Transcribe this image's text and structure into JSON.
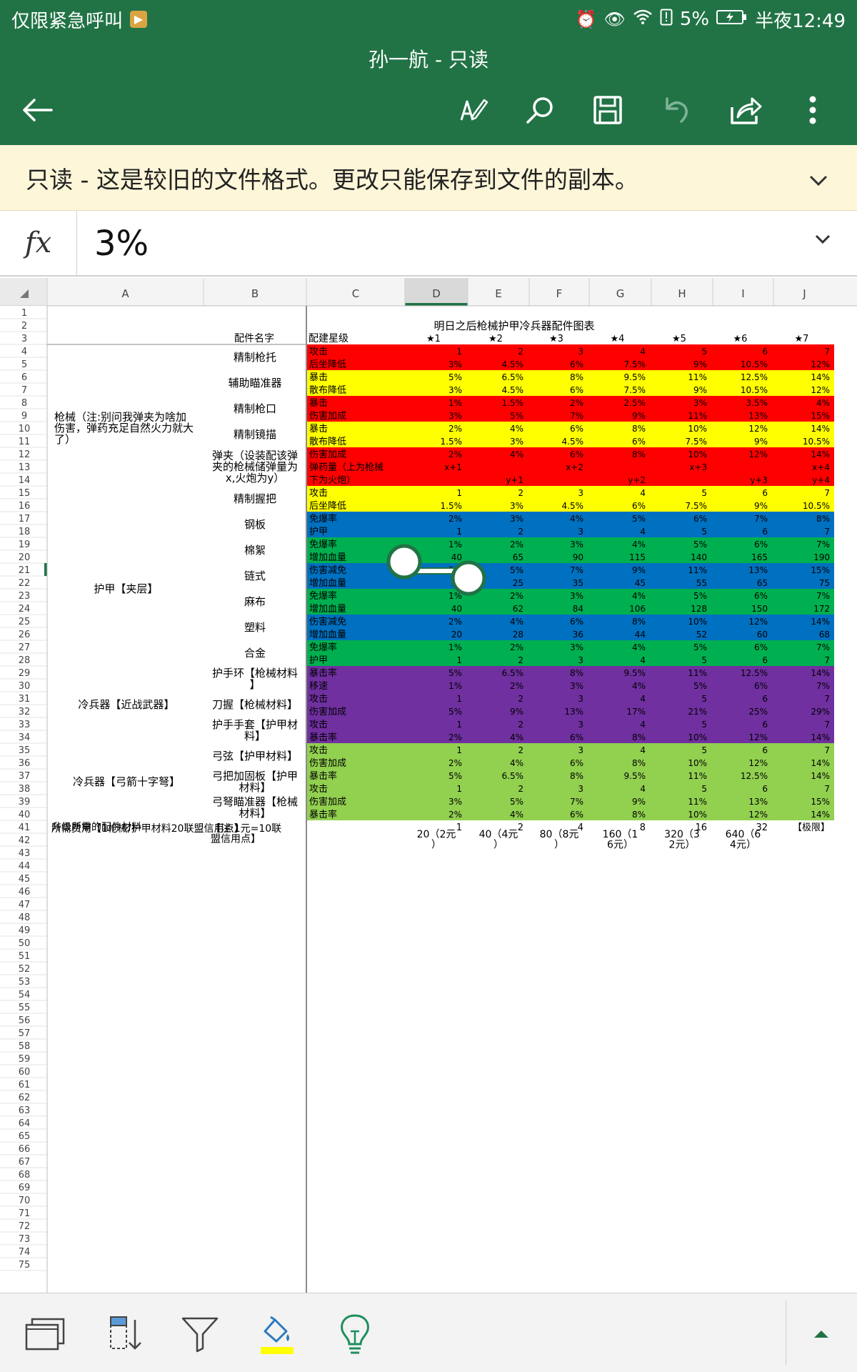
{
  "status": {
    "carrier": "仅限紧急呼叫",
    "battery": "5%",
    "time": "半夜12:49"
  },
  "appbar": {
    "title": "孙一航 - 只读",
    "icons": [
      "back-arrow-icon",
      "draw-pen-icon",
      "search-icon",
      "save-icon",
      "undo-icon",
      "share-icon",
      "more-vert-icon"
    ]
  },
  "banner": {
    "text": "只读 - 这是较旧的文件格式。更改只能保存到文件的副本。"
  },
  "formula": {
    "fx": "fx",
    "value": "3%"
  },
  "colors": {
    "red": "#ff0000",
    "yellow": "#ffff00",
    "blue": "#0070c0",
    "green": "#00b050",
    "purple": "#7030a0",
    "lime": "#92d050",
    "excel_green": "#217346"
  },
  "sheet": {
    "columns": [
      "A",
      "B",
      "C",
      "D",
      "E",
      "F",
      "G",
      "H",
      "I",
      "J"
    ],
    "selected_column": "D",
    "selected_row": 21,
    "row_count": 75,
    "title": "明日之后枪械护甲冷兵器配件图表",
    "header_row": {
      "b": "配件名字",
      "c": "配建星级",
      "stars": [
        "★1",
        "★2",
        "★3",
        "★4",
        "★5",
        "★6",
        "★7"
      ]
    },
    "groups": [
      {
        "start": 4,
        "end": 16,
        "text": "枪械（注:别问我弹夹为啥加伤害，弹药充足自然火力就大了）"
      },
      {
        "start": 17,
        "end": 28,
        "text": "护甲【夹层】"
      },
      {
        "start": 29,
        "end": 34,
        "text": "冷兵器【近战武器】"
      },
      {
        "start": 35,
        "end": 40,
        "text": "冷兵器【弓箭十字弩】"
      }
    ],
    "parts": [
      {
        "start": 4,
        "end": 5,
        "name": "精制枪托"
      },
      {
        "start": 6,
        "end": 7,
        "name": "辅助瞄准器"
      },
      {
        "start": 8,
        "end": 9,
        "name": "精制枪口"
      },
      {
        "start": 10,
        "end": 11,
        "name": "精制镜描"
      },
      {
        "start": 12,
        "end": 14,
        "name": "弹夹（设装配该弹夹的枪械储弹量为x,火炮为y）"
      },
      {
        "start": 15,
        "end": 16,
        "name": "精制握把"
      },
      {
        "start": 17,
        "end": 18,
        "name": "钢板"
      },
      {
        "start": 19,
        "end": 20,
        "name": "棉絮"
      },
      {
        "start": 21,
        "end": 22,
        "name": "链式"
      },
      {
        "start": 23,
        "end": 24,
        "name": "麻布"
      },
      {
        "start": 25,
        "end": 26,
        "name": "塑料"
      },
      {
        "start": 27,
        "end": 28,
        "name": "合金"
      },
      {
        "start": 29,
        "end": 30,
        "name": "护手环【枪械材料】"
      },
      {
        "start": 31,
        "end": 32,
        "name": "刀握【枪械材料】"
      },
      {
        "start": 33,
        "end": 34,
        "name": "护手手套【护甲材料】"
      },
      {
        "start": 35,
        "end": 36,
        "name": "弓弦【护甲材料】"
      },
      {
        "start": 37,
        "end": 38,
        "name": "弓把加固板【护甲材料】"
      },
      {
        "start": 39,
        "end": 40,
        "name": "弓弩瞄准器【枪械材料】"
      }
    ],
    "rows": [
      {
        "r": 4,
        "color": "red",
        "label": "攻击",
        "values": [
          "1",
          "2",
          "3",
          "4",
          "5",
          "6",
          "7"
        ]
      },
      {
        "r": 5,
        "color": "red",
        "label": "后坐降低",
        "values": [
          "3%",
          "4.5%",
          "6%",
          "7.5%",
          "9%",
          "10.5%",
          "12%"
        ]
      },
      {
        "r": 6,
        "color": "yellow",
        "label": "暴击",
        "values": [
          "5%",
          "6.5%",
          "8%",
          "9.5%",
          "11%",
          "12.5%",
          "14%"
        ]
      },
      {
        "r": 7,
        "color": "yellow",
        "label": "散布降低",
        "values": [
          "3%",
          "4.5%",
          "6%",
          "7.5%",
          "9%",
          "10.5%",
          "12%"
        ]
      },
      {
        "r": 8,
        "color": "red",
        "label": "暴击",
        "values": [
          "1%",
          "1.5%",
          "2%",
          "2.5%",
          "3%",
          "3.5%",
          "4%"
        ]
      },
      {
        "r": 9,
        "color": "red",
        "label": "伤害加成",
        "values": [
          "3%",
          "5%",
          "7%",
          "9%",
          "11%",
          "13%",
          "15%"
        ]
      },
      {
        "r": 10,
        "color": "yellow",
        "label": "暴击",
        "values": [
          "2%",
          "4%",
          "6%",
          "8%",
          "10%",
          "12%",
          "14%"
        ]
      },
      {
        "r": 11,
        "color": "yellow",
        "label": "散布降低",
        "values": [
          "1.5%",
          "3%",
          "4.5%",
          "6%",
          "7.5%",
          "9%",
          "10.5%"
        ]
      },
      {
        "r": 12,
        "color": "red",
        "label": "伤害加成",
        "values": [
          "2%",
          "4%",
          "6%",
          "8%",
          "10%",
          "12%",
          "14%"
        ]
      },
      {
        "r": 13,
        "color": "red",
        "label": "弹药量（上为枪械",
        "values": [
          "x+1",
          "",
          "x+2",
          "",
          "x+3",
          "",
          "x+4"
        ]
      },
      {
        "r": 14,
        "color": "red",
        "label": "下为火炮）",
        "values": [
          "",
          "y+1",
          "",
          "y+2",
          "",
          "y+3",
          "y+4"
        ]
      },
      {
        "r": 15,
        "color": "yellow",
        "label": "攻击",
        "values": [
          "1",
          "2",
          "3",
          "4",
          "5",
          "6",
          "7"
        ]
      },
      {
        "r": 16,
        "color": "yellow",
        "label": "后坐降低",
        "values": [
          "1.5%",
          "3%",
          "4.5%",
          "6%",
          "7.5%",
          "9%",
          "10.5%"
        ]
      },
      {
        "r": 17,
        "color": "blue",
        "label": "免爆率",
        "values": [
          "2%",
          "3%",
          "4%",
          "5%",
          "6%",
          "7%",
          "8%"
        ]
      },
      {
        "r": 18,
        "color": "blue",
        "label": "护甲",
        "values": [
          "1",
          "2",
          "3",
          "4",
          "5",
          "6",
          "7"
        ]
      },
      {
        "r": 19,
        "color": "green",
        "label": "免爆率",
        "values": [
          "1%",
          "2%",
          "3%",
          "4%",
          "5%",
          "6%",
          "7%"
        ]
      },
      {
        "r": 20,
        "color": "green",
        "label": "增加血量",
        "values": [
          "40",
          "65",
          "90",
          "115",
          "140",
          "165",
          "190"
        ]
      },
      {
        "r": 21,
        "color": "blue",
        "label": "伤害减免",
        "values": [
          "3%",
          "5%",
          "7%",
          "9%",
          "11%",
          "13%",
          "15%"
        ]
      },
      {
        "r": 22,
        "color": "blue",
        "label": "增加血量",
        "values": [
          "15",
          "25",
          "35",
          "45",
          "55",
          "65",
          "75"
        ]
      },
      {
        "r": 23,
        "color": "green",
        "label": "免爆率",
        "values": [
          "1%",
          "2%",
          "3%",
          "4%",
          "5%",
          "6%",
          "7%"
        ]
      },
      {
        "r": 24,
        "color": "green",
        "label": "增加血量",
        "values": [
          "40",
          "62",
          "84",
          "106",
          "128",
          "150",
          "172"
        ]
      },
      {
        "r": 25,
        "color": "blue",
        "label": "伤害减免",
        "values": [
          "2%",
          "4%",
          "6%",
          "8%",
          "10%",
          "12%",
          "14%"
        ]
      },
      {
        "r": 26,
        "color": "blue",
        "label": "增加血量",
        "values": [
          "20",
          "28",
          "36",
          "44",
          "52",
          "60",
          "68"
        ]
      },
      {
        "r": 27,
        "color": "green",
        "label": "免爆率",
        "values": [
          "1%",
          "2%",
          "3%",
          "4%",
          "5%",
          "6%",
          "7%"
        ]
      },
      {
        "r": 28,
        "color": "green",
        "label": "护甲",
        "values": [
          "1",
          "2",
          "3",
          "4",
          "5",
          "6",
          "7"
        ]
      },
      {
        "r": 29,
        "color": "purple",
        "label": "暴击率",
        "values": [
          "5%",
          "6.5%",
          "8%",
          "9.5%",
          "11%",
          "12.5%",
          "14%"
        ]
      },
      {
        "r": 30,
        "color": "purple",
        "label": "移速",
        "values": [
          "1%",
          "2%",
          "3%",
          "4%",
          "5%",
          "6%",
          "7%"
        ]
      },
      {
        "r": 31,
        "color": "purple",
        "label": "攻击",
        "values": [
          "1",
          "2",
          "3",
          "4",
          "5",
          "6",
          "7"
        ]
      },
      {
        "r": 32,
        "color": "purple",
        "label": "伤害加成",
        "values": [
          "5%",
          "9%",
          "13%",
          "17%",
          "21%",
          "25%",
          "29%"
        ]
      },
      {
        "r": 33,
        "color": "purple",
        "label": "攻击",
        "values": [
          "1",
          "2",
          "3",
          "4",
          "5",
          "6",
          "7"
        ]
      },
      {
        "r": 34,
        "color": "purple",
        "label": "暴击率",
        "values": [
          "2%",
          "4%",
          "6%",
          "8%",
          "10%",
          "12%",
          "14%"
        ]
      },
      {
        "r": 35,
        "color": "lime",
        "label": "攻击",
        "values": [
          "1",
          "2",
          "3",
          "4",
          "5",
          "6",
          "7"
        ]
      },
      {
        "r": 36,
        "color": "lime",
        "label": "伤害加成",
        "values": [
          "2%",
          "4%",
          "6%",
          "8%",
          "10%",
          "12%",
          "14%"
        ]
      },
      {
        "r": 37,
        "color": "lime",
        "label": "暴击率",
        "values": [
          "5%",
          "6.5%",
          "8%",
          "9.5%",
          "11%",
          "12.5%",
          "14%"
        ]
      },
      {
        "r": 38,
        "color": "lime",
        "label": "攻击",
        "values": [
          "1",
          "2",
          "3",
          "4",
          "5",
          "6",
          "7"
        ]
      },
      {
        "r": 39,
        "color": "lime",
        "label": "伤害加成",
        "values": [
          "3%",
          "5%",
          "7%",
          "9%",
          "11%",
          "13%",
          "15%"
        ]
      },
      {
        "r": 40,
        "color": "lime",
        "label": "暴击率",
        "values": [
          "2%",
          "4%",
          "6%",
          "8%",
          "10%",
          "12%",
          "14%"
        ]
      }
    ],
    "row41": {
      "a": "升级所需的配件材料",
      "values": [
        "1",
        "2",
        "4",
        "8",
        "16",
        "32",
        "【极限】"
      ]
    },
    "row42": {
      "a": "所需费用【1枪械/护甲材料20联盟信用点】",
      "b": "【注:1元=10联盟信用点】",
      "values": [
        "20（2元）",
        "40（4元）",
        "80（8元）",
        "160（16元）",
        "320（32元）",
        "640（64元）"
      ]
    }
  },
  "bottombar": {
    "icons": [
      "freeze-panes-icon",
      "sort-icon",
      "filter-icon",
      "fill-color-icon",
      "tell-me-lightbulb-icon",
      "collapse-up-icon"
    ]
  }
}
